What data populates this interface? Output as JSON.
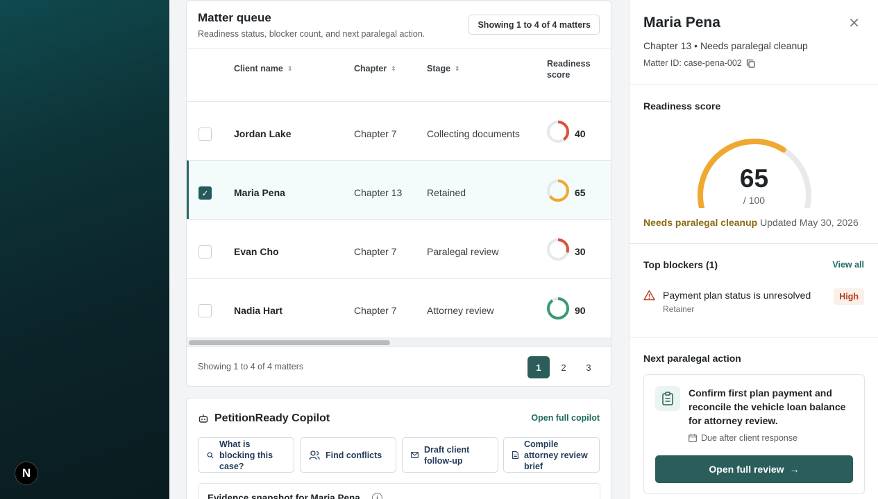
{
  "app": {
    "badge": "N"
  },
  "queue": {
    "title": "Matter queue",
    "subtitle": "Readiness status, blocker count, and next paralegal action.",
    "showing_pill": "Showing 1 to 4 of 4 matters",
    "columns": {
      "client": "Client name",
      "chapter": "Chapter",
      "stage": "Stage",
      "score": "Readiness score"
    },
    "rows": [
      {
        "name": "Jordan Lake",
        "chapter": "Chapter 7",
        "stage": "Collecting documents",
        "score": "40",
        "selected": false
      },
      {
        "name": "Maria Pena",
        "chapter": "Chapter 13",
        "stage": "Retained",
        "score": "65",
        "selected": true
      },
      {
        "name": "Evan Cho",
        "chapter": "Chapter 7",
        "stage": "Paralegal review",
        "score": "30",
        "selected": false
      },
      {
        "name": "Nadia Hart",
        "chapter": "Chapter 7",
        "stage": "Attorney review",
        "score": "90",
        "selected": false
      }
    ],
    "footer_text": "Showing 1 to 4 of 4 matters",
    "pages": [
      "1",
      "2",
      "3"
    ],
    "active_page": "1"
  },
  "copilot": {
    "title": "PetitionReady Copilot",
    "open_link": "Open full copilot",
    "chips": [
      {
        "label": "What is blocking this case?",
        "icon": "search-icon"
      },
      {
        "label": "Find conflicts",
        "icon": "users-icon"
      },
      {
        "label": "Draft client follow-up",
        "icon": "mail-icon"
      },
      {
        "label": "Compile attorney review brief",
        "icon": "document-icon"
      }
    ],
    "evidence_title": "Evidence snapshot for Maria Pena",
    "info_icon": "i"
  },
  "detail": {
    "name": "Maria Pena",
    "subtitle": "Chapter 13 • Needs paralegal cleanup",
    "matter_id": "Matter ID: case-pena-002",
    "readiness_title": "Readiness score",
    "score": "65",
    "score_denominator": "/ 100",
    "score_fraction": 0.65,
    "status_label": "Needs paralegal cleanup",
    "updated": "Updated May 30, 2026",
    "blockers_title": "Top blockers (1)",
    "view_all": "View all",
    "blocker": {
      "title": "Payment plan status is unresolved",
      "category": "Retainer",
      "severity": "High"
    },
    "next_action_title": "Next paralegal action",
    "next_action": "Confirm first plan payment and reconcile the vehicle loan balance for attorney review.",
    "due": "Due after client response",
    "review_button": "Open full review"
  },
  "colors": {
    "accent": "#2b5e5b",
    "gauge_amber": "#f0a830",
    "ring_red": "#d9533a",
    "ring_amber": "#f0a830",
    "ring_green": "#3a9a72",
    "high": "#b0411f"
  }
}
